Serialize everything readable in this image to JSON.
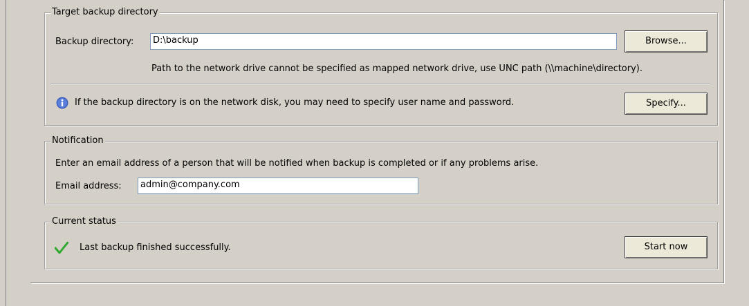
{
  "target_group": {
    "title": "Target backup directory",
    "directory_label": "Backup directory:",
    "directory_value": "D:\\backup",
    "browse_label": "Browse...",
    "path_note": "Path to the network drive cannot be specified as mapped network drive, use UNC path (\\\\machine\\directory).",
    "info_text": "If the backup directory is on the network disk, you may need to specify user name and password.",
    "info_icon": "info-icon",
    "specify_label": "Specify..."
  },
  "notification_group": {
    "title": "Notification",
    "description": "Enter an email address of a person that will be notified when backup is completed or if any problems arise.",
    "email_label": "Email address:",
    "email_value": "admin@company.com"
  },
  "status_group": {
    "title": "Current status",
    "status_icon": "checkmark-icon",
    "status_text": "Last backup finished successfully.",
    "start_label": "Start now"
  },
  "colors": {
    "background": "#d4d0c8",
    "info_icon": "#3f5fbf",
    "success_check": "#2ea82e"
  }
}
